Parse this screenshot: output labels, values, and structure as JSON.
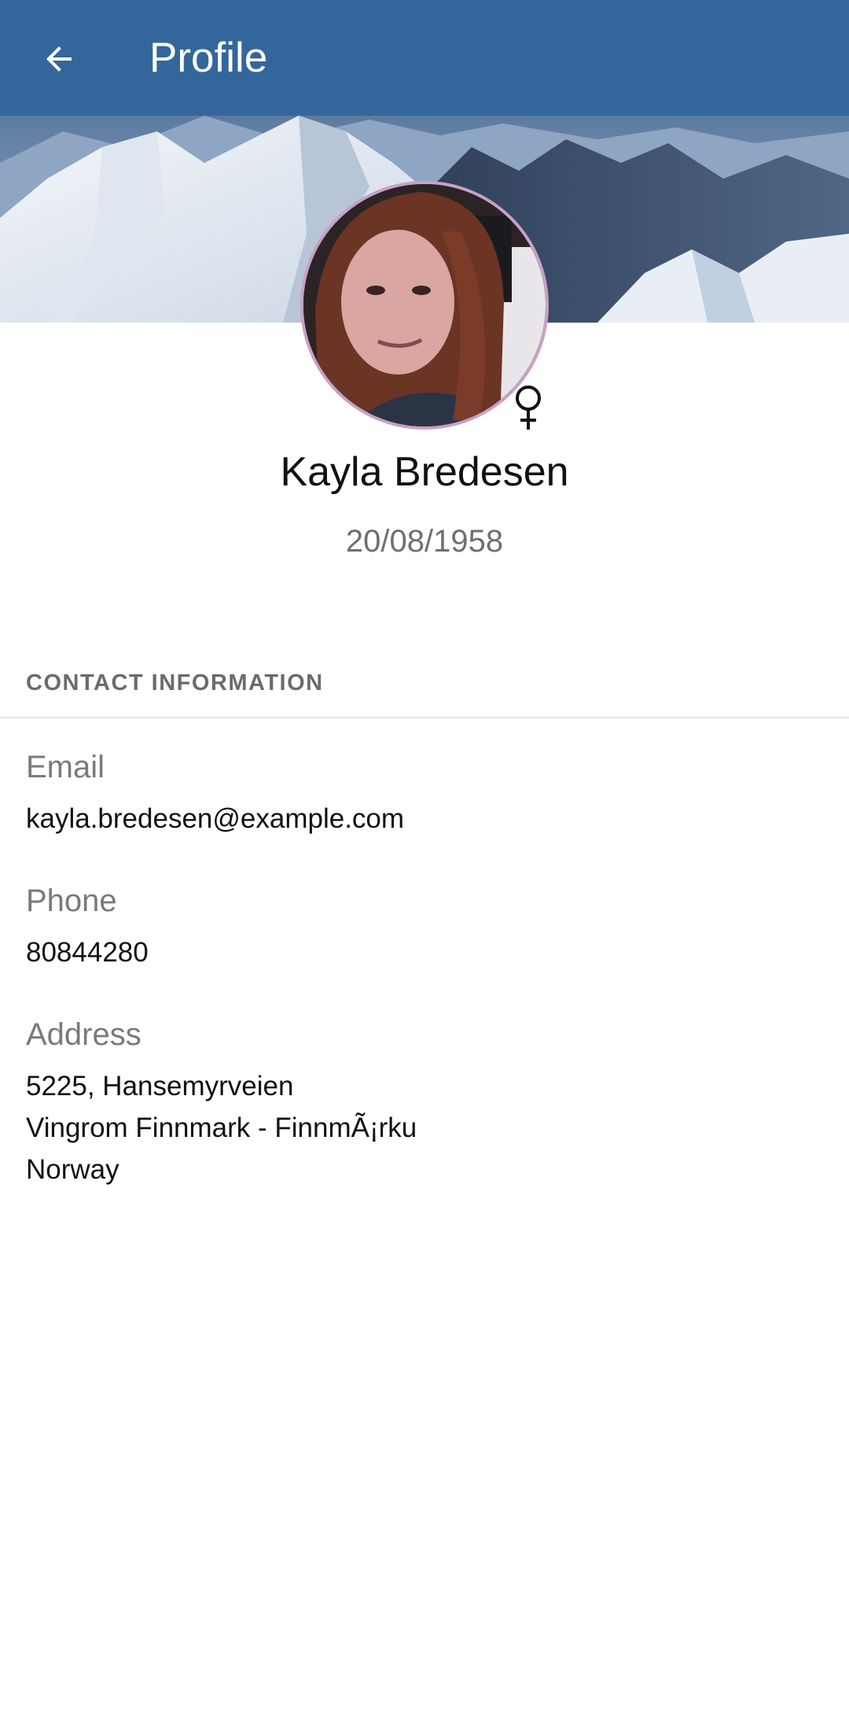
{
  "appbar": {
    "title": "Profile",
    "back_icon": "arrow-left-icon",
    "color": "#33679c"
  },
  "profile": {
    "name": "Kayla Bredesen",
    "dob": "20/08/1958",
    "gender_icon": "female-symbol-icon"
  },
  "contact": {
    "section_title": "CONTACT INFORMATION",
    "email_label": "Email",
    "email": "kayla.bredesen@example.com",
    "phone_label": "Phone",
    "phone": "80844280",
    "address_label": "Address",
    "address_line1": "5225, Hansemyrveien",
    "address_line2": "Vingrom Finnmark - FinnmÃ¡rku",
    "address_line3": "Norway"
  }
}
